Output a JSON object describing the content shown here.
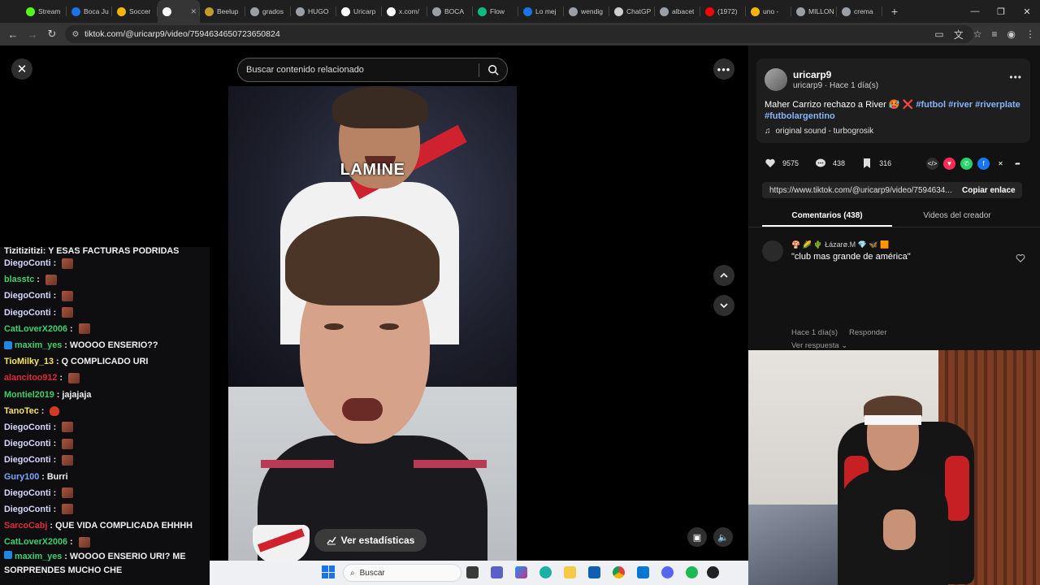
{
  "browser": {
    "tabs": [
      {
        "label": "Stream",
        "color": "#53fc18"
      },
      {
        "label": "Boca Ju",
        "color": "#1a73e8"
      },
      {
        "label": "Soccer",
        "color": "#f4b400"
      },
      {
        "label": "",
        "color": "#ffffff",
        "active": true
      },
      {
        "label": "Beelup",
        "color": "#c49a2a"
      },
      {
        "label": "grados",
        "color": "#9aa0a6"
      },
      {
        "label": "HUGO",
        "color": "#9aa0a6"
      },
      {
        "label": "Uricarp",
        "color": "#ffffff"
      },
      {
        "label": "x.com/",
        "color": "#ffffff"
      },
      {
        "label": "BOCA",
        "color": "#9aa0a6"
      },
      {
        "label": "Flow",
        "color": "#10b981"
      },
      {
        "label": "Lo mej",
        "color": "#1a73e8"
      },
      {
        "label": "wendig",
        "color": "#9aa0a6"
      },
      {
        "label": "ChatGP",
        "color": "#cfcfcf"
      },
      {
        "label": "albacet",
        "color": "#9aa0a6"
      },
      {
        "label": "(1972)",
        "color": "#ff0000"
      },
      {
        "label": "uno -",
        "color": "#f4b400"
      },
      {
        "label": "MILLON",
        "color": "#9aa0a6"
      },
      {
        "label": "crema",
        "color": "#9aa0a6"
      }
    ],
    "new_tab": "+",
    "url": "tiktok.com/@uricarp9/video/7594634650723650824"
  },
  "tiktok": {
    "search_placeholder": "Buscar contenido relacionado",
    "video_caption_overlay": "LAMINE",
    "stats_button": "Ver estadísticas",
    "author": {
      "username": "uricarp9",
      "subline": "uricarp9 · Hace 1 día(s)"
    },
    "caption_text": "Maher Carrizo rechazo a River",
    "hashtags": [
      "#futbol",
      "#river",
      "#riverplate",
      "#futbolargentino"
    ],
    "sound": "original sound - turbogrosik",
    "likes": "9575",
    "comments_count": "438",
    "saves": "316",
    "share_link": "https://www.tiktok.com/@uricarp9/video/7594634...",
    "copy_link": "Copiar enlace",
    "tab_comments": "Comentarios (438)",
    "tab_creator": "Videos del creador",
    "comment": {
      "user": "🍄 🌽 🌵 Łázarø.M 💎 🦋 🟧",
      "text": "\"club mas grande de américa\"",
      "time": "Hace 1 día(s)",
      "reply": "Responder",
      "view_replies": "Ver respuesta"
    }
  },
  "chat": {
    "first_line": {
      "user": "Tizitizitizi",
      "text": " : Y ESAS FACTURAS PODRIDAS"
    },
    "messages": [
      {
        "user": "DiegoConti",
        "color": "#d7d7ff",
        "sep": " : ",
        "text": "",
        "emote": true
      },
      {
        "user": "blasstc",
        "color": "#3ccf6e",
        "sep": " : ",
        "text": "",
        "emote": true
      },
      {
        "user": "DiegoConti",
        "color": "#d7d7ff",
        "sep": " : ",
        "text": "",
        "emote": true
      },
      {
        "user": "DiegoConti",
        "color": "#d7d7ff",
        "sep": " : ",
        "text": "",
        "emote": true
      },
      {
        "user": "CatLoverX2006",
        "color": "#3ccf6e",
        "sep": " : ",
        "text": "",
        "emote": true
      },
      {
        "user": "maxim_yes",
        "color": "#3ccf6e",
        "sep": " : ",
        "text": "WOOOO ENSERIO??",
        "badge": true
      },
      {
        "user": "TioMilky_13",
        "color": "#f5e663",
        "sep": " : ",
        "text": "Q COMPLICADO URI"
      },
      {
        "user": "alancitoo912",
        "color": "#e0283c",
        "sep": " : ",
        "text": "",
        "emote": true
      },
      {
        "user": "Montiel2019",
        "color": "#3ccf6e",
        "sep": " : ",
        "text": "jajajaja"
      },
      {
        "user": "TanoTec",
        "color": "#f5e663",
        "sep": " : ",
        "text": "",
        "fire": true
      },
      {
        "user": "DiegoConti",
        "color": "#d7d7ff",
        "sep": " : ",
        "text": "",
        "emote": true
      },
      {
        "user": "DiegoConti",
        "color": "#d7d7ff",
        "sep": " : ",
        "text": "",
        "emote": true
      },
      {
        "user": "DiegoConti",
        "color": "#d7d7ff",
        "sep": " : ",
        "text": "",
        "emote": true
      },
      {
        "user": "Gury100",
        "color": "#7aa7ff",
        "sep": " : ",
        "text": "Burri"
      },
      {
        "user": "DiegoConti",
        "color": "#d7d7ff",
        "sep": " : ",
        "text": "",
        "emote": true
      },
      {
        "user": "DiegoConti",
        "color": "#d7d7ff",
        "sep": " : ",
        "text": "",
        "emote": true
      },
      {
        "user": "SarcoCabj",
        "color": "#e0283c",
        "sep": " : ",
        "text": "QUE VIDA COMPLICADA EHHHH"
      },
      {
        "user": "CatLoverX2006",
        "color": "#3ccf6e",
        "sep": " : ",
        "text": "",
        "emote": true
      }
    ],
    "last": {
      "user": "maxim_yes",
      "text": " : WOOOO ENSERIO URI? ME SORPRENDES MUCHO CHE"
    }
  },
  "taskbar": {
    "search": "Buscar"
  }
}
